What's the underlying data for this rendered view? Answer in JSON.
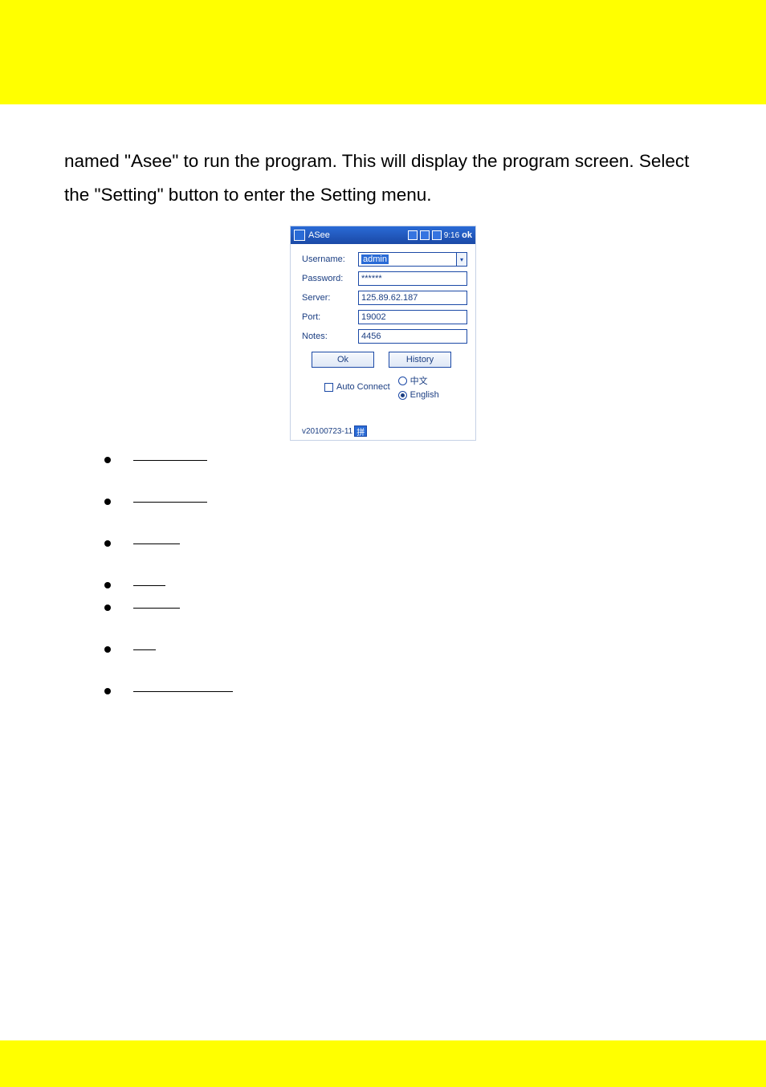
{
  "lead": "named \"Asee\" to run the program. This will display the program screen. Select the \"Setting\" button to enter the Setting menu.",
  "asee": {
    "title": "ASee",
    "status_time": "9:16",
    "status_ok": "ok",
    "labels": {
      "username": "Username:",
      "password": "Password:",
      "server": "Server:",
      "port": "Port:",
      "notes": "Notes:"
    },
    "values": {
      "username": "admin",
      "password": "******",
      "server": "125.89.62.187",
      "port": "19002",
      "notes": "4456"
    },
    "buttons": {
      "ok": "Ok",
      "history": "History"
    },
    "options": {
      "auto_connect": "Auto Connect",
      "lang_zh": "中文",
      "lang_en": "English"
    },
    "version": "v20100723-11",
    "ime": "拼"
  }
}
